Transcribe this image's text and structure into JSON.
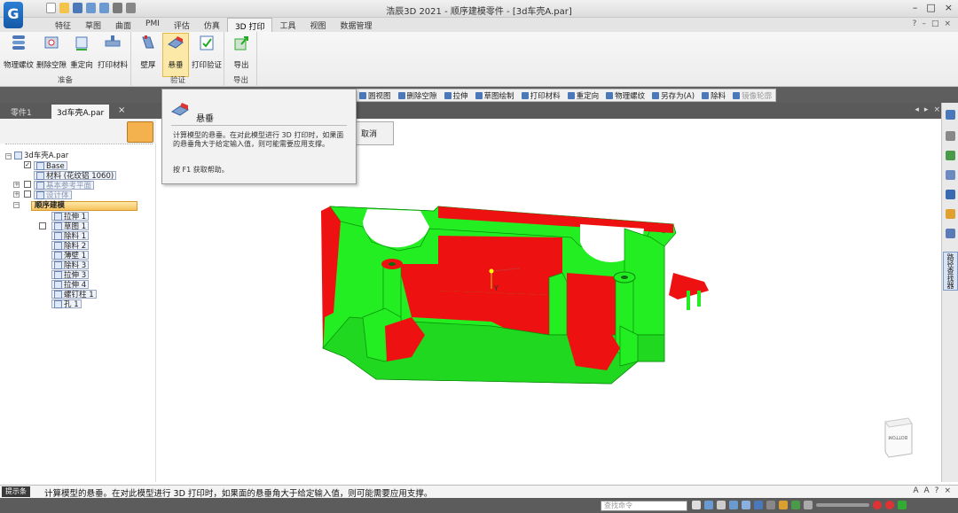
{
  "app": {
    "logo_text": "G",
    "window_title": "浩辰3D 2021 - 顺序建模零件 - [3d车壳A.par]",
    "window_buttons": [
      "–",
      "□",
      "×"
    ]
  },
  "ribbon_tabs": [
    "特征",
    "草图",
    "曲面",
    "PMI",
    "评估",
    "仿真",
    "3D 打印",
    "工具",
    "视图",
    "数据管理"
  ],
  "active_tab_index": 6,
  "help_icons": [
    "?",
    "–",
    "□",
    "×"
  ],
  "ribbon": {
    "groups": [
      {
        "label": "准备",
        "buttons": [
          "物理螺纹",
          "删除空隙",
          "重定向",
          "打印材料"
        ]
      },
      {
        "label": "验证",
        "buttons": [
          "壁厚",
          "悬垂",
          "打印验证"
        ]
      },
      {
        "label": "导出",
        "buttons": [
          "导出"
        ]
      }
    ]
  },
  "command_bar": {
    "items": [
      "圆视图",
      "删除空隙",
      "拉伸",
      "草图绘制",
      "打印材料",
      "重定向",
      "物理螺纹",
      "另存为(A)",
      "除料"
    ],
    "disabled_item": "镜像轮廓"
  },
  "doc_tabs": [
    "零件1",
    "3d车壳A.par"
  ],
  "active_doc_tab": 1,
  "tree": {
    "root": "3d车壳A.par",
    "base": "Base",
    "material": "材料 (花纹铝 1060)",
    "ref_planes": "基本参考平面",
    "design_body": "设计体",
    "sequence": "顺序建模",
    "features": [
      "拉伸 1",
      "草图 1",
      "除料 1",
      "除料 2",
      "薄壁 1",
      "除料 3",
      "拉伸 3",
      "拉伸 4",
      "螺钉柱 1",
      "孔 1"
    ]
  },
  "tooltip": {
    "title": "悬垂",
    "description": "计算模型的悬垂。在对此模型进行 3D 打印时，如果面的悬垂角大于给定输入值，则可能需要应用支撑。",
    "help": "按 F1 获取帮助。"
  },
  "cancel_label": "取消",
  "viewcube_label": "BOTTOM",
  "axis_label": "Y",
  "right_rail_tab": "路径查找器",
  "status": {
    "prompt_button": "提示条",
    "prompt_text": "计算模型的悬垂。在对此模型进行 3D 打印时，如果面的悬垂角大于给定输入值，则可能需要应用支撑。",
    "right_items": [
      "A",
      "A",
      "?",
      "×"
    ]
  },
  "command_input_placeholder": "查找命令",
  "colors": {
    "model_green": "#22ee22",
    "model_red": "#ee1111",
    "active_highlight": "#fce9a8"
  }
}
